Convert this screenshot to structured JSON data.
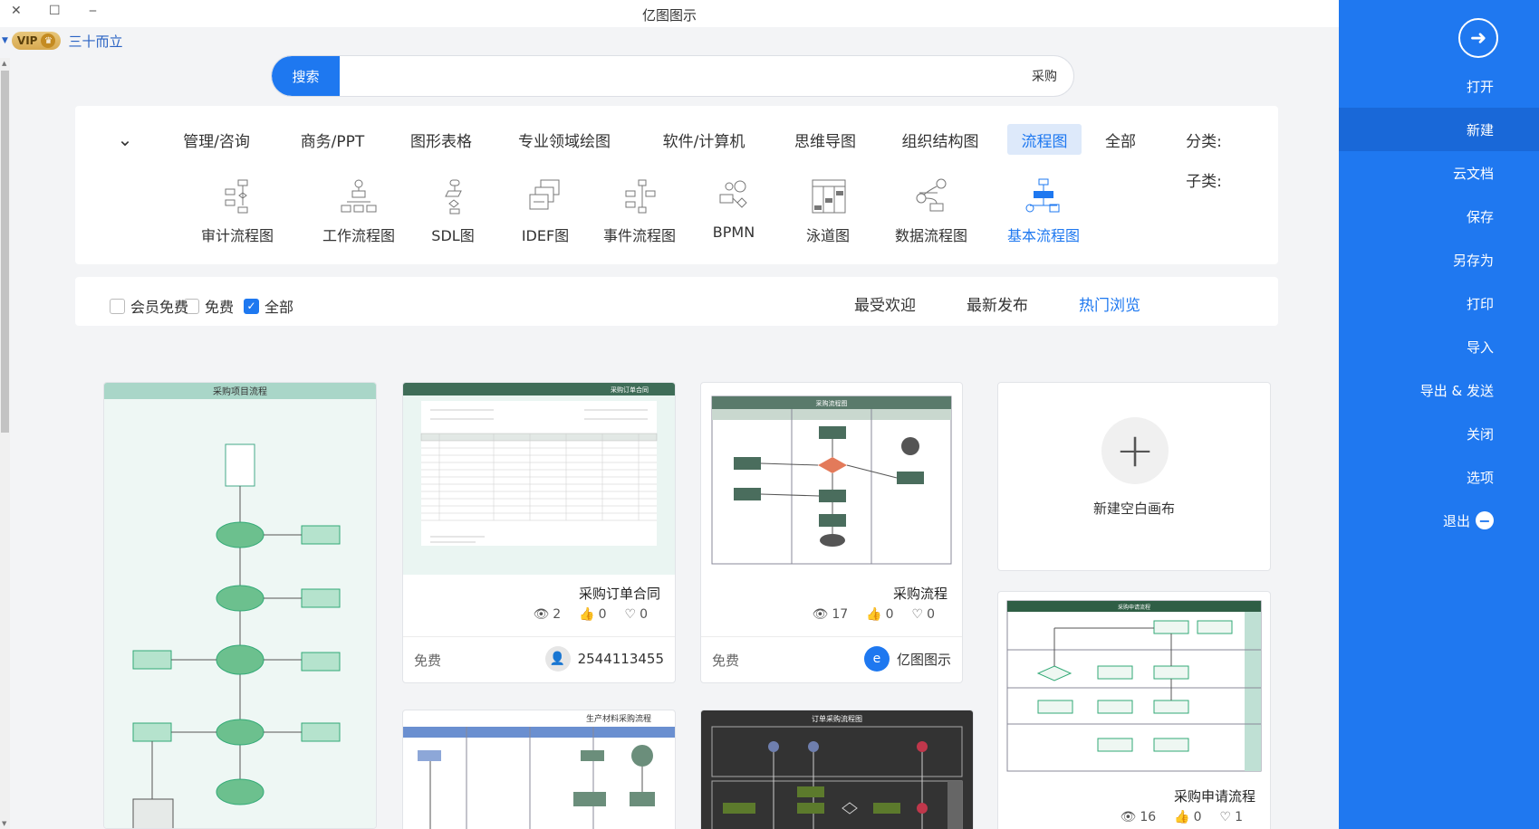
{
  "window": {
    "title": "亿图图示"
  },
  "user": {
    "name": "三十而立",
    "badge": "VIP"
  },
  "search": {
    "button_label": "搜索",
    "value": "采购"
  },
  "categories": {
    "label": "分类:",
    "items": [
      "全部",
      "流程图",
      "组织结构图",
      "思维导图",
      "软件/计算机",
      "专业领域绘图",
      "图形表格",
      "商务/PPT",
      "管理/咨询"
    ],
    "active": "流程图"
  },
  "subcategories": {
    "label": "子类:",
    "items": [
      "基本流程图",
      "数据流程图",
      "泳道图",
      "BPMN",
      "事件流程图",
      "IDEF图",
      "SDL图",
      "工作流程图",
      "审计流程图"
    ],
    "active": "基本流程图"
  },
  "sort_tabs": {
    "items": [
      "热门浏览",
      "最新发布",
      "最受欢迎"
    ],
    "active": "热门浏览"
  },
  "price_filters": {
    "items": [
      "全部",
      "免费",
      "会员免费"
    ],
    "checked": "全部"
  },
  "new_canvas": {
    "label": "新建空白画布"
  },
  "cards": [
    {
      "title": "采购流程",
      "views": "17",
      "likes": "0",
      "favorites": "0",
      "author": "亿图图示",
      "price": "免费",
      "thumb_title": "采购流程图"
    },
    {
      "title": "采购订单合同",
      "views": "2",
      "likes": "0",
      "favorites": "0",
      "author": "2544113455",
      "price": "免费",
      "thumb_title": "采购订单合同"
    },
    {
      "title": "采购申请流程",
      "views": "16",
      "likes": "0",
      "favorites": "1",
      "thumb_title": "采购申请流程"
    },
    {
      "title": "采购项目流程",
      "thumb_title": "采购项目流程"
    },
    {
      "title": "生产材料采购流程",
      "thumb_title": "生产材料采购流程"
    },
    {
      "title": "订单采购流程",
      "thumb_title": "订单采购流程图"
    }
  ],
  "sidebar": {
    "items": [
      "打开",
      "新建",
      "云文档",
      "保存",
      "另存为",
      "打印",
      "导入",
      "导出 & 发送",
      "关闭",
      "选项",
      "退出"
    ],
    "active": "新建"
  },
  "colors": {
    "accent": "#1f78f0",
    "active_bg": "#dde9fa"
  }
}
